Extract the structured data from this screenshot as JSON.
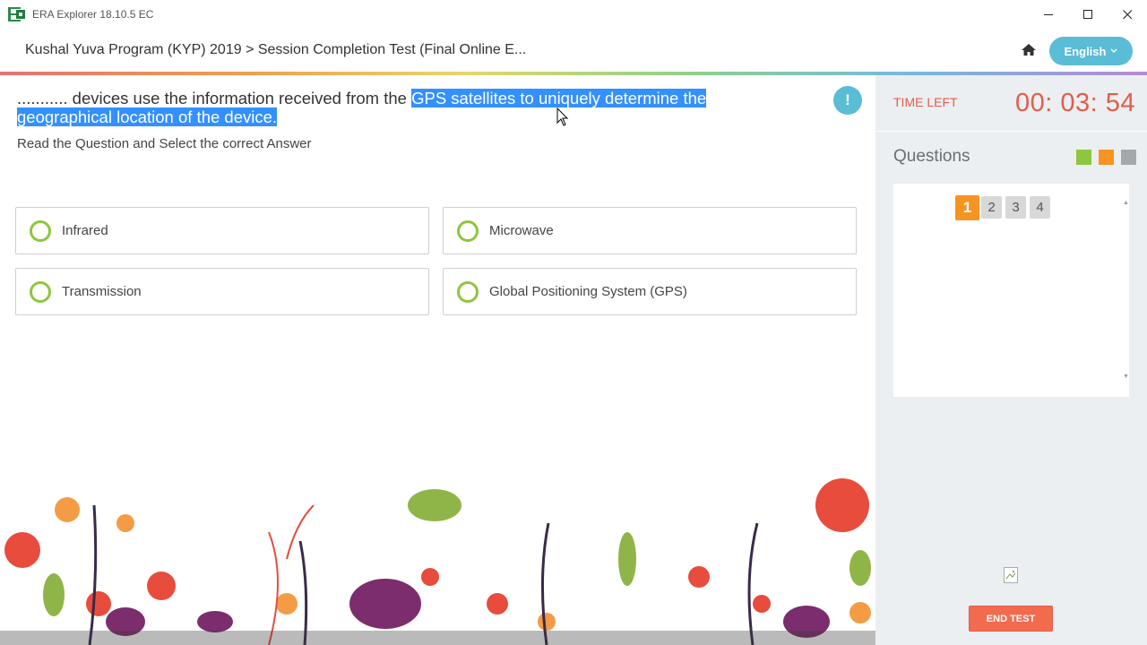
{
  "window": {
    "title": "ERA Explorer 18.10.5 EC",
    "minimize": "—",
    "maximize": "☐",
    "close": "✕"
  },
  "header": {
    "breadcrumb": "Kushal Yuva Program (KYP) 2019 > Session Completion Test (Final Online E...",
    "home_icon": "home-icon",
    "language_label": "English",
    "language_chevron": "˅"
  },
  "question": {
    "text_plain": "........... devices use the information received from the",
    "text_highlighted_1": "GPS satellites to uniquely determine the",
    "text_highlighted_2": "geographical location of the device.",
    "instruction": "Read the Question and Select the correct Answer",
    "info_label": "!",
    "options": [
      {
        "label": "Infrared"
      },
      {
        "label": "Microwave"
      },
      {
        "label": "Transmission"
      },
      {
        "label": "Global Positioning System (GPS)"
      }
    ]
  },
  "sidebar": {
    "time_left_label": "TIME LEFT",
    "time_left_value": "00: 03: 54",
    "questions_heading": "Questions",
    "legend_colors": [
      "#8dc63f",
      "#f79421",
      "#a4a8ab"
    ],
    "question_numbers": [
      "1",
      "2",
      "3",
      "4"
    ],
    "active_question": "1",
    "scroll_up": "▲",
    "scroll_down": "▼",
    "end_test_label": "END TEST"
  },
  "colors": {
    "accent": "#5bbcd6",
    "timer": "#e25c4b",
    "active": "#f79421",
    "radio": "#8dc63f",
    "highlight": "#3390ff"
  }
}
